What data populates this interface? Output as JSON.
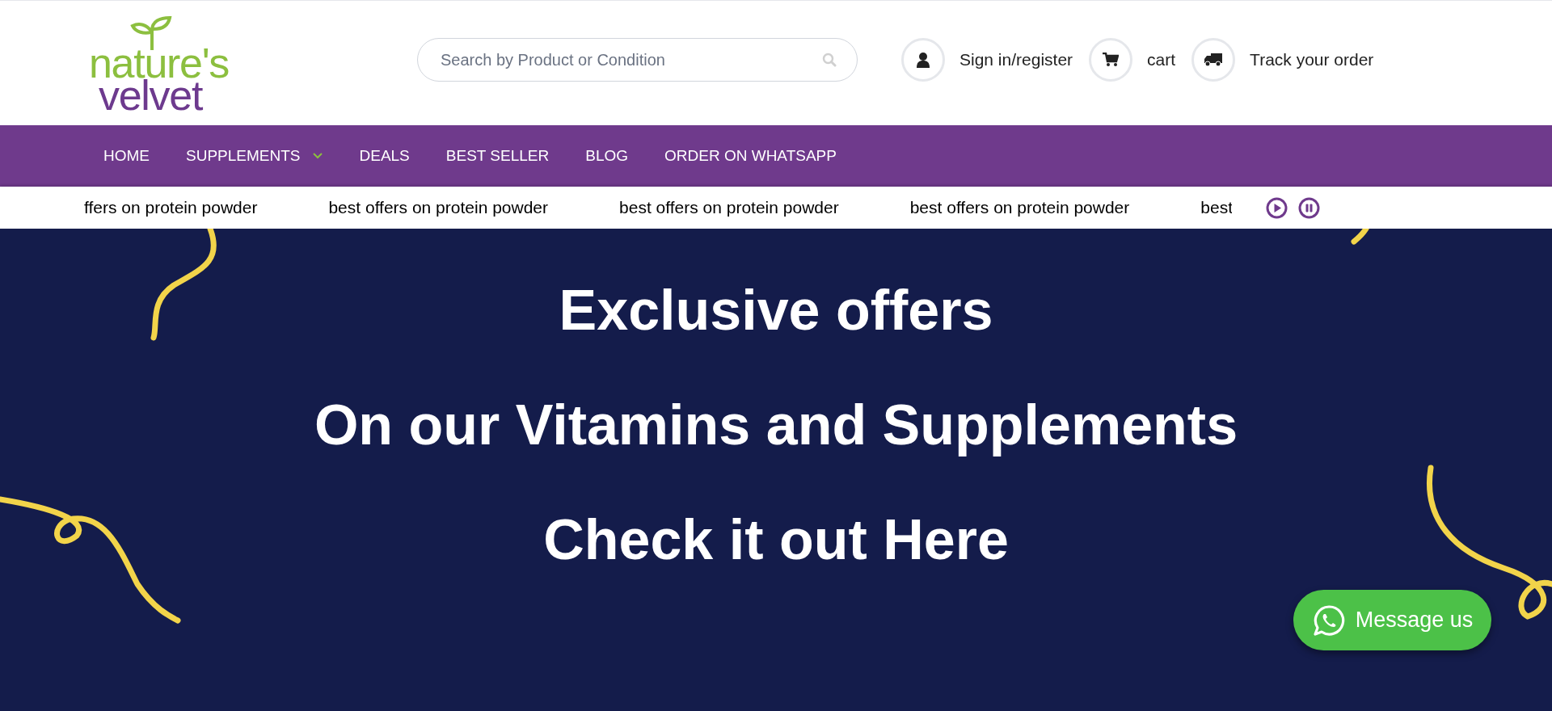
{
  "logo": {
    "line_1": "nature's",
    "line_2": "velvet"
  },
  "search": {
    "placeholder": "Search by Product or Condition"
  },
  "header_links": [
    {
      "kind": "user",
      "label": "Sign in/register"
    },
    {
      "kind": "cart",
      "label": "cart"
    },
    {
      "kind": "truck",
      "label": "Track your order"
    }
  ],
  "nav": [
    {
      "label": "HOME",
      "dropdown": false
    },
    {
      "label": "SUPPLEMENTS",
      "dropdown": true
    },
    {
      "label": "DEALS",
      "dropdown": false
    },
    {
      "label": "BEST SELLER",
      "dropdown": false
    },
    {
      "label": "BLOG",
      "dropdown": false
    },
    {
      "label": "ORDER ON WHATSAPP",
      "dropdown": false
    }
  ],
  "ticker": {
    "items": [
      "ffers on protein powder",
      "best offers on protein powder",
      "best offers on protein powder",
      "best offers on protein powder",
      "best"
    ]
  },
  "banner": {
    "lines": [
      "Exclusive offers",
      "On our Vitamins and Supplements",
      "Check it out Here"
    ]
  },
  "chat_button": {
    "label": "Message us"
  }
}
